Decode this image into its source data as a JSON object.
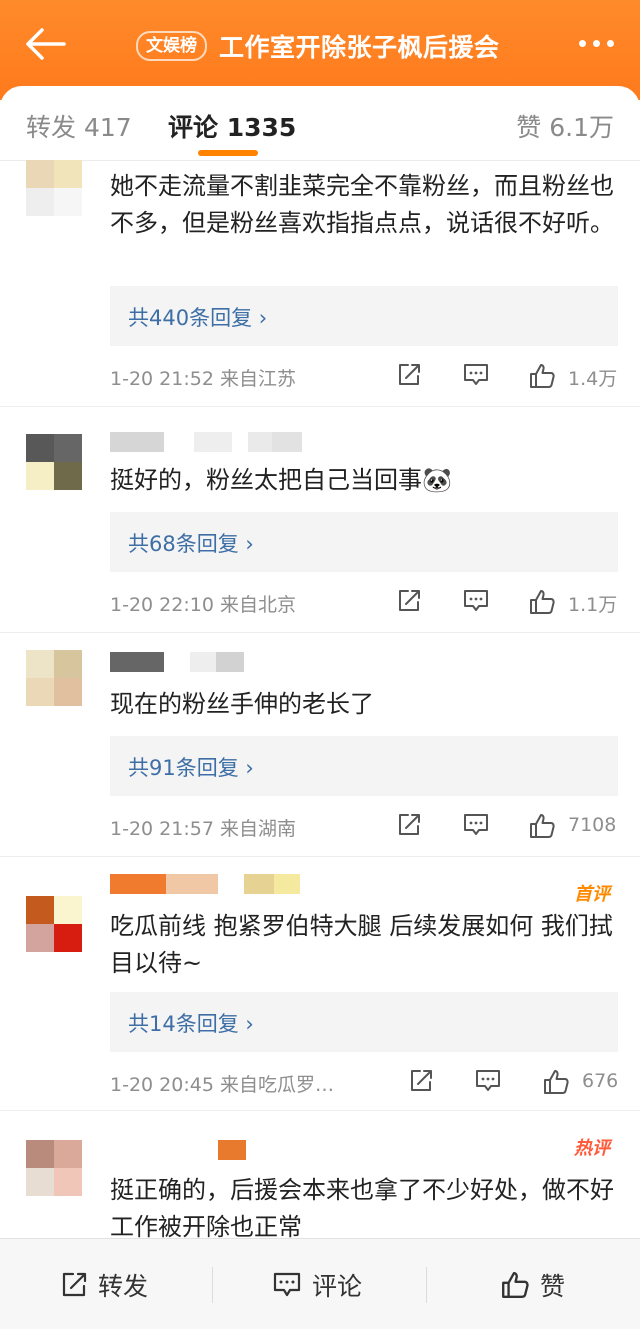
{
  "header": {
    "badge": "文娱榜",
    "title": "工作室开除张子枫后援会",
    "back_icon": "back-arrow-icon",
    "more_icon": "more-dots-icon",
    "bg_color": "#ff7a1c"
  },
  "tabs": {
    "repost": "转发 417",
    "comment": "评论 1335",
    "like": "赞 6.1万",
    "accent": "#ff8200"
  },
  "comments": [
    {
      "text": "她不走流量不割韭菜完全不靠粉丝，而且粉丝也不多，但是粉丝喜欢指指点点，说话很不好听。",
      "replies": "共440条回复 ›",
      "time": "1-20 21:52  来自江苏",
      "likes": "1.4万"
    },
    {
      "text": "挺好的，粉丝太把自己当回事🐼",
      "replies": "共68条回复 ›",
      "time": "1-20 22:10  来自北京",
      "likes": "1.1万"
    },
    {
      "text": "现在的粉丝手伸的老长了",
      "replies": "共91条回复 ›",
      "time": "1-20 21:57  来自湖南",
      "likes": "7108"
    },
    {
      "badge": "首评",
      "text": "吃瓜前线 抱紧罗伯特大腿 后续发展如何 我们拭目以待~",
      "replies": "共14条回复 ›",
      "time": "1-20 20:45  来自吃瓜罗…",
      "likes": "676"
    },
    {
      "badge": "热评",
      "text": "挺正确的，后援会本来也拿了不少好处，做不好工作被开除也正常"
    }
  ],
  "bottom_bar": {
    "repost": "转发",
    "comment": "评论",
    "like": "赞"
  }
}
